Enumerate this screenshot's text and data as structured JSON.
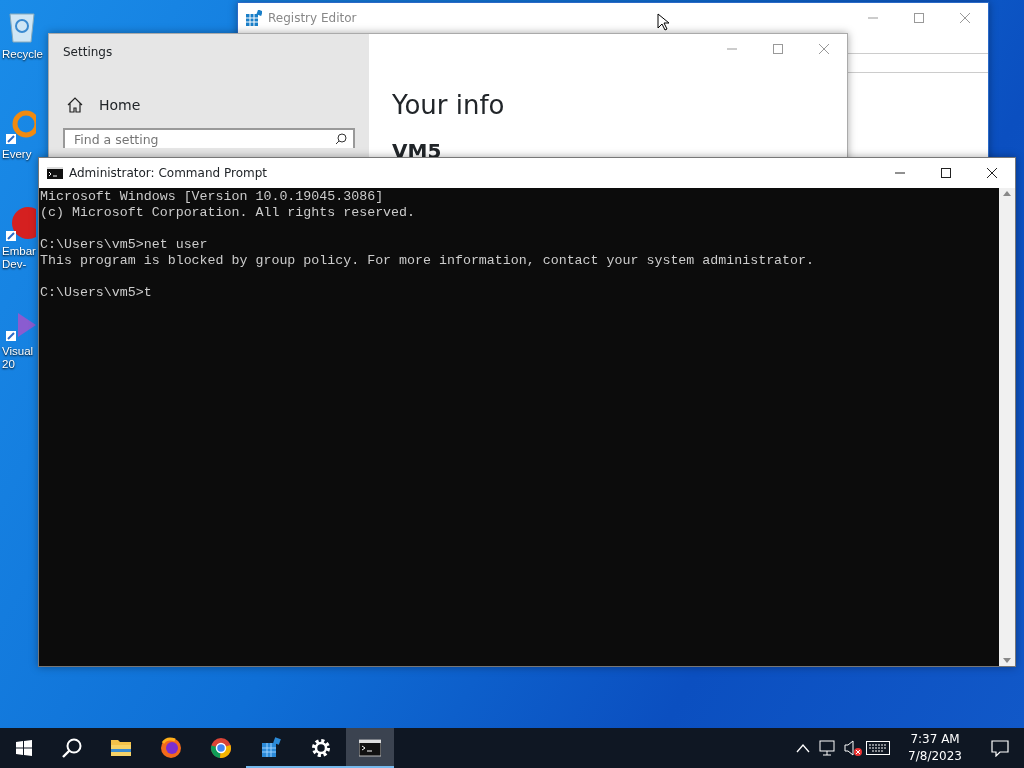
{
  "desktop_icons": [
    {
      "kind": "recycle",
      "lines": [
        "Recycle"
      ]
    },
    {
      "kind": "search",
      "lines": [
        "Every"
      ]
    },
    {
      "kind": "delphi",
      "lines": [
        "Embar",
        "Dev-"
      ]
    },
    {
      "kind": "studio",
      "lines": [
        "Visual",
        "20"
      ]
    }
  ],
  "registry_editor": {
    "title": "Registry Editor"
  },
  "settings": {
    "title": "Settings",
    "home": "Home",
    "search": {
      "placeholder": "Find a setting"
    },
    "heading": "Your info",
    "user": "VM5"
  },
  "command_prompt": {
    "title": "Administrator:  Command Prompt",
    "blocks": [
      [
        "Microsoft Windows [Version 10.0.19045.3086]",
        "(c) Microsoft Corporation. All rights reserved."
      ],
      [
        "C:\\Users\\vm5>net user",
        "This program is blocked by group policy. For more information, contact your system administrator."
      ],
      [
        "C:\\Users\\vm5>t"
      ]
    ]
  },
  "taskbar": {
    "apps": [
      {
        "kind": "explorer",
        "running": false,
        "selected": false
      },
      {
        "kind": "firefox",
        "running": false,
        "selected": false
      },
      {
        "kind": "chrome",
        "running": false,
        "selected": false
      },
      {
        "kind": "regedit",
        "running": true,
        "selected": false
      },
      {
        "kind": "settings",
        "running": true,
        "selected": false
      },
      {
        "kind": "console",
        "running": true,
        "selected": true
      }
    ],
    "time": "7:37 AM",
    "date": "7/8/2023"
  }
}
